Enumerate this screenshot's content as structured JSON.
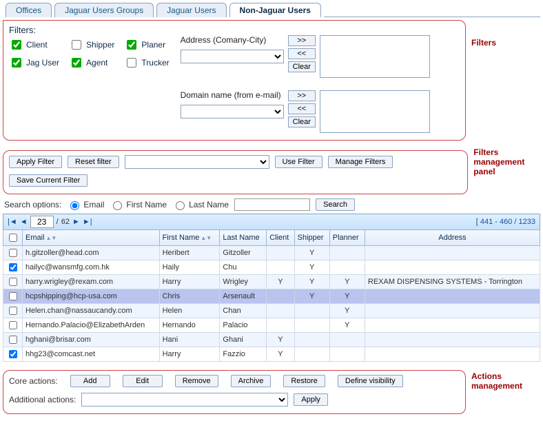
{
  "tabs": {
    "items": [
      {
        "label": "Offices",
        "active": false
      },
      {
        "label": "Jaguar Users Groups",
        "active": false
      },
      {
        "label": "Jaguar Users",
        "active": false
      },
      {
        "label": "Non-Jaguar Users",
        "active": true
      }
    ]
  },
  "filters": {
    "title": "Filters:",
    "checks": [
      {
        "label": "Client",
        "checked": true
      },
      {
        "label": "Shipper",
        "checked": false
      },
      {
        "label": "Planer",
        "checked": true
      },
      {
        "label": "Jag User",
        "checked": true
      },
      {
        "label": "Agent",
        "checked": true
      },
      {
        "label": "Trucker",
        "checked": false
      }
    ],
    "address": {
      "label": "Address (Comany-City)",
      "btn_add": ">>",
      "btn_rem": "<<",
      "btn_clear": "Clear"
    },
    "domain": {
      "label": "Domain name (from e-mail)",
      "btn_add": ">>",
      "btn_rem": "<<",
      "btn_clear": "Clear"
    },
    "side_label": "Filters"
  },
  "mgmt": {
    "apply": "Apply Filter",
    "reset": "Reset filter",
    "use": "Use Filter",
    "manage": "Manage Filters",
    "save": "Save Current Filter",
    "side_label_1": "Filters",
    "side_label_2": "management",
    "side_label_3": "panel"
  },
  "search": {
    "label": "Search options:",
    "opt_email": "Email",
    "opt_first": "First Name",
    "opt_last": "Last Name",
    "selected": "email",
    "btn": "Search"
  },
  "pager": {
    "page": "23",
    "total_pages": "62",
    "range": "[ 441 - 460 / 1233"
  },
  "table": {
    "headers": {
      "chk": "",
      "email": "Email",
      "first": "First Name",
      "last": "Last Name",
      "client": "Client",
      "shipper": "Shipper",
      "planner": "Planner",
      "address": "Address"
    },
    "rows": [
      {
        "chk": false,
        "email": "h.gitzoller@head.com",
        "first": "Heribert",
        "last": "Gitzoller",
        "client": "",
        "shipper": "Y",
        "planner": "",
        "address": ""
      },
      {
        "chk": true,
        "email": "hailyc@wansmfg.com.hk",
        "first": "Haily",
        "last": "Chu",
        "client": "",
        "shipper": "Y",
        "planner": "",
        "address": ""
      },
      {
        "chk": false,
        "email": "harry.wrigley@rexam.com",
        "first": "Harry",
        "last": "Wrigley",
        "client": "Y",
        "shipper": "Y",
        "planner": "Y",
        "address": "REXAM DISPENSING SYSTEMS - Torrington"
      },
      {
        "chk": false,
        "email": "hcpshipping@hcp-usa.com",
        "first": "Chris",
        "last": "Arsenault",
        "client": "",
        "shipper": "Y",
        "planner": "Y",
        "address": "",
        "selected": true
      },
      {
        "chk": false,
        "email": "Helen.chan@nassaucandy.com",
        "first": "Helen",
        "last": "Chan",
        "client": "",
        "shipper": "",
        "planner": "Y",
        "address": ""
      },
      {
        "chk": false,
        "email": "Hernando.Palacio@ElizabethArden",
        "first": "Hernando",
        "last": "Palacio",
        "client": "",
        "shipper": "",
        "planner": "Y",
        "address": ""
      },
      {
        "chk": false,
        "email": "hghani@brisar.com",
        "first": "Hani",
        "last": "Ghani",
        "client": "Y",
        "shipper": "",
        "planner": "",
        "address": ""
      },
      {
        "chk": true,
        "email": "hhg23@comcast.net",
        "first": "Harry",
        "last": "Fazzio",
        "client": "Y",
        "shipper": "",
        "planner": "",
        "address": ""
      }
    ]
  },
  "actions": {
    "core_label": "Core actions:",
    "add": "Add",
    "edit": "Edit",
    "remove": "Remove",
    "archive": "Archive",
    "restore": "Restore",
    "visibility": "Define visibility",
    "addl_label": "Additional actions:",
    "apply": "Apply",
    "side_label_1": "Actions",
    "side_label_2": "management"
  }
}
